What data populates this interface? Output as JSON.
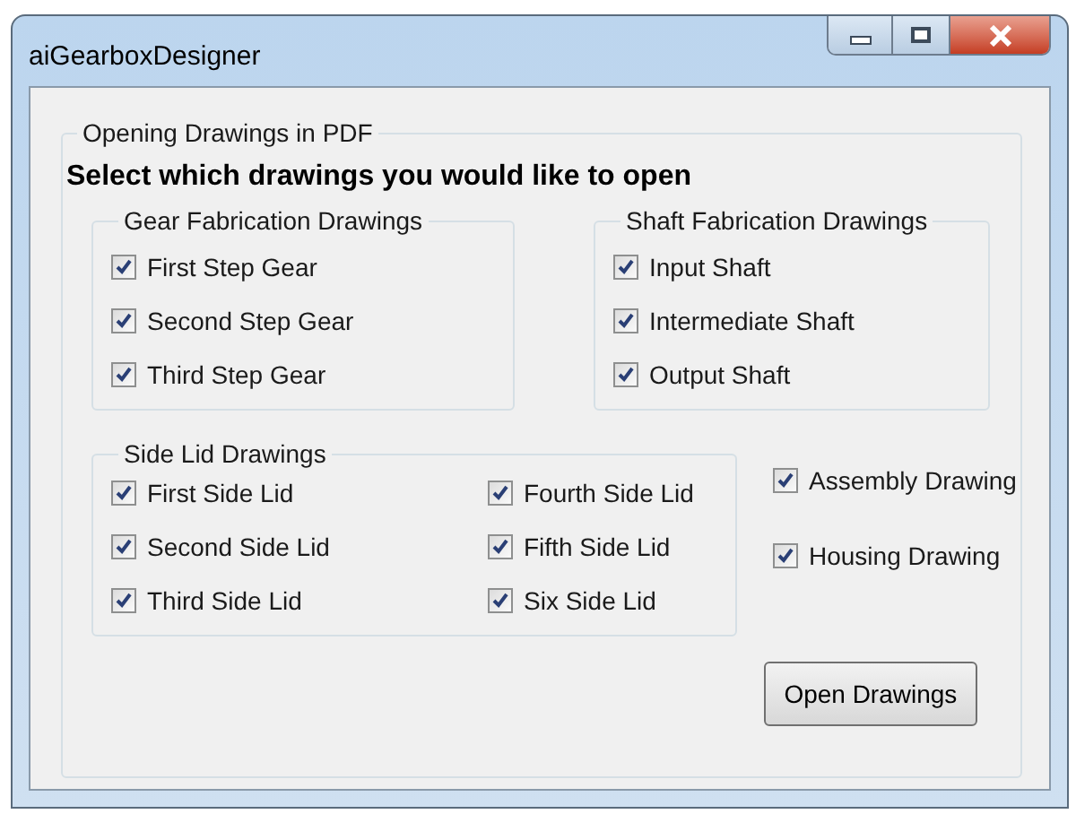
{
  "window": {
    "title": "aiGearboxDesigner"
  },
  "group": {
    "title": "Opening Drawings in PDF",
    "heading": "Select which drawings you would like to open"
  },
  "gear_group": {
    "title": "Gear Fabrication Drawings",
    "items": [
      {
        "label": "First Step Gear",
        "checked": true
      },
      {
        "label": "Second Step Gear",
        "checked": true
      },
      {
        "label": "Third Step Gear",
        "checked": true
      }
    ]
  },
  "shaft_group": {
    "title": "Shaft Fabrication Drawings",
    "items": [
      {
        "label": "Input Shaft",
        "checked": true
      },
      {
        "label": "Intermediate Shaft",
        "checked": true
      },
      {
        "label": "Output Shaft",
        "checked": true
      }
    ]
  },
  "side_lid_group": {
    "title": "Side Lid Drawings",
    "items": [
      {
        "label": "First Side Lid",
        "checked": true
      },
      {
        "label": "Second Side Lid",
        "checked": true
      },
      {
        "label": "Third Side Lid",
        "checked": true
      },
      {
        "label": "Fourth Side Lid",
        "checked": true
      },
      {
        "label": "Fifth Side Lid",
        "checked": true
      },
      {
        "label": "Six Side Lid",
        "checked": true
      }
    ]
  },
  "other_items": [
    {
      "label": "Assembly Drawing",
      "checked": true
    },
    {
      "label": "Housing Drawing",
      "checked": true
    }
  ],
  "open_button": "Open Drawings"
}
